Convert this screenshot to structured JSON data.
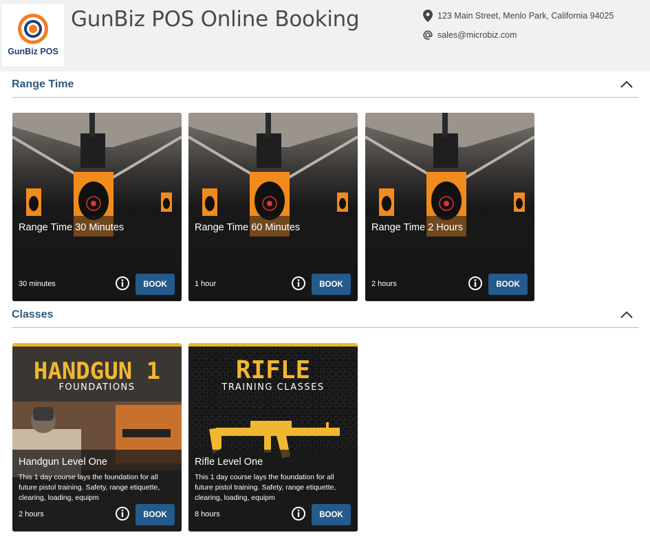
{
  "header": {
    "logo_text": "GunBiz POS",
    "title": "GunBiz POS Online Booking",
    "address": "123 Main Street, Menlo Park, California 94025",
    "email": "sales@microbiz.com",
    "address_icon": "map-pin-icon",
    "email_icon": "at-sign-icon"
  },
  "sections": [
    {
      "title": "Range Time",
      "items": [
        {
          "title": "Range Time 30 Minutes",
          "duration": "30 minutes",
          "book_label": "BOOK"
        },
        {
          "title": "Range Time 60 Minutes",
          "duration": "1 hour",
          "book_label": "BOOK"
        },
        {
          "title": "Range Time 2 Hours",
          "duration": "2 hours",
          "book_label": "BOOK"
        }
      ]
    },
    {
      "title": "Classes",
      "items": [
        {
          "banner_big": "HANDGUN 1",
          "banner_sub": "FOUNDATIONS",
          "title": "Handgun Level One",
          "description": "This 1 day course lays the foundation for all future pistol training. Safety, range etiquette, clearing, loading, equipm",
          "duration": "2 hours",
          "book_label": "BOOK"
        },
        {
          "banner_big": "RIFLE",
          "banner_sub": "TRAINING CLASSES",
          "title": "Rifle Level One",
          "description": "This 1 day course lays the foundation for all future pistol training. Safety, range etiquette, clearing, loading, equipm",
          "duration": "8 hours",
          "book_label": "BOOK"
        }
      ]
    }
  ],
  "colors": {
    "accent": "#245a8c",
    "section_title": "#2d5a80",
    "class_banner": "#f2b731",
    "target_orange": "#f28a1e"
  }
}
